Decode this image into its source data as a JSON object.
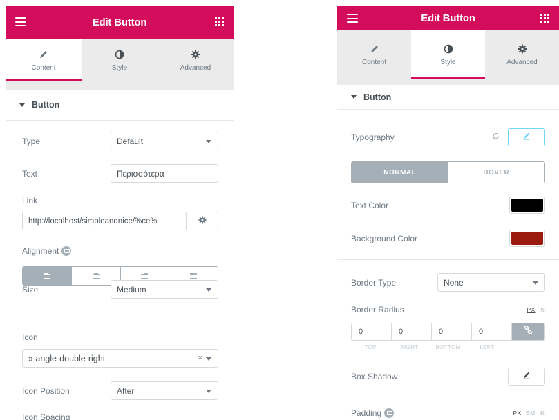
{
  "left": {
    "header": {
      "title": "Edit Button"
    },
    "tabs": [
      {
        "label": "Content",
        "icon": "pencil-icon"
      },
      {
        "label": "Style",
        "icon": "contrast-icon"
      },
      {
        "label": "Advanced",
        "icon": "gear-icon"
      }
    ],
    "active_tab": "Content",
    "section": {
      "title": "Button"
    },
    "fields": {
      "type": {
        "label": "Type",
        "value": "Default"
      },
      "text": {
        "label": "Text",
        "value": "Περισσότερα"
      },
      "link": {
        "label": "Link",
        "value": "http://localhost/simpleandnice/%ce%"
      },
      "alignment": {
        "label": "Alignment"
      },
      "size": {
        "label": "Size",
        "value": "Medium"
      },
      "icon": {
        "label": "Icon",
        "value": "» angle-double-right",
        "clear": "×"
      },
      "icon_position": {
        "label": "Icon Position",
        "value": "After"
      },
      "icon_spacing": {
        "label": "Icon Spacing"
      }
    }
  },
  "right": {
    "header": {
      "title": "Edit Button"
    },
    "tabs": [
      {
        "label": "Content",
        "icon": "pencil-icon"
      },
      {
        "label": "Style",
        "icon": "contrast-icon"
      },
      {
        "label": "Advanced",
        "icon": "gear-icon"
      }
    ],
    "active_tab": "Style",
    "section": {
      "title": "Button"
    },
    "typography": {
      "label": "Typography"
    },
    "state_toggle": {
      "normal": "NORMAL",
      "hover": "HOVER"
    },
    "text_color": {
      "label": "Text Color",
      "value": "#000000"
    },
    "background_color": {
      "label": "Background Color",
      "value": "#9a1a10"
    },
    "border_type": {
      "label": "Border Type",
      "value": "None"
    },
    "border_radius": {
      "label": "Border Radius",
      "units": [
        "PX",
        "%"
      ],
      "values": [
        "0",
        "0",
        "0",
        "0"
      ],
      "sides": [
        "TOP",
        "RIGHT",
        "BOTTOM",
        "LEFT"
      ]
    },
    "box_shadow": {
      "label": "Box Shadow"
    },
    "padding": {
      "label": "Padding",
      "units": [
        "PX",
        "EM",
        "%"
      ]
    }
  }
}
